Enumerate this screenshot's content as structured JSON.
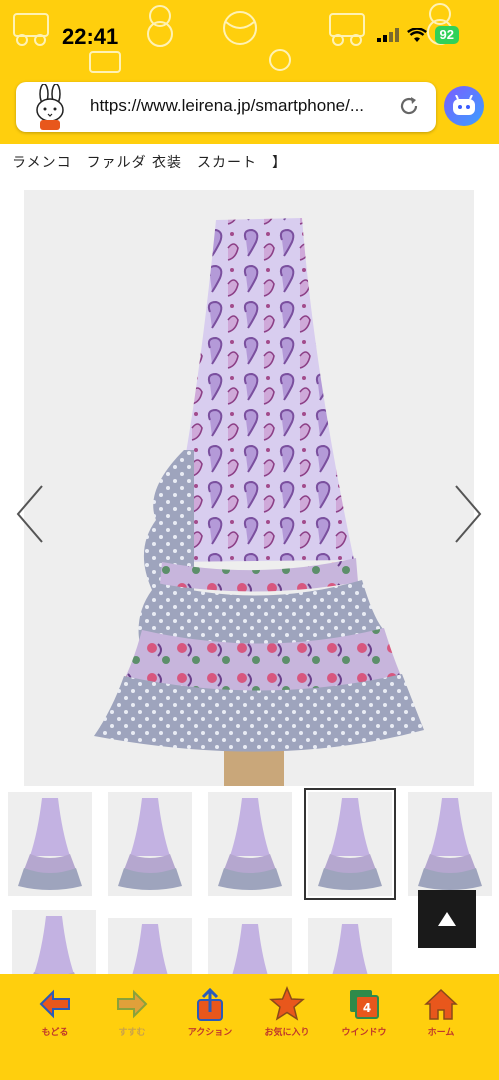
{
  "status": {
    "time": "22:41",
    "battery": "92"
  },
  "browser": {
    "url": "https://www.leirena.jp/smartphone/..."
  },
  "page": {
    "title": "ラメンコ　ファルダ 衣装　スカート　】"
  },
  "gallery": {
    "thumbnails": [
      {
        "name": "thumb-1"
      },
      {
        "name": "thumb-2"
      },
      {
        "name": "thumb-3"
      },
      {
        "name": "thumb-4",
        "selected": true
      },
      {
        "name": "thumb-5"
      },
      {
        "name": "thumb-6"
      },
      {
        "name": "thumb-7"
      },
      {
        "name": "thumb-8"
      },
      {
        "name": "thumb-9"
      }
    ]
  },
  "toolbar": {
    "items": [
      {
        "label": "もどる",
        "icon": "back-arrow-icon"
      },
      {
        "label": "すすむ",
        "icon": "forward-arrow-icon"
      },
      {
        "label": "アクション",
        "icon": "share-icon"
      },
      {
        "label": "お気に入り",
        "icon": "star-icon"
      },
      {
        "label": "ウインドウ",
        "icon": "windows-icon",
        "count": "4"
      },
      {
        "label": "ホーム",
        "icon": "home-icon"
      }
    ]
  },
  "colors": {
    "brand_yellow": "#ffcf0d",
    "label_red": "#c0392b",
    "skirt_lavender": "#b9a6df",
    "ruffle_grey": "#9ea4bd"
  }
}
